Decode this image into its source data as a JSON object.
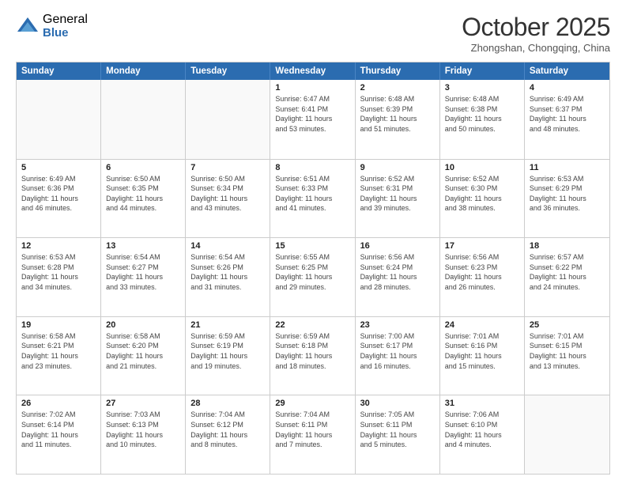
{
  "logo": {
    "general": "General",
    "blue": "Blue"
  },
  "header": {
    "month": "October 2025",
    "location": "Zhongshan, Chongqing, China"
  },
  "weekdays": [
    "Sunday",
    "Monday",
    "Tuesday",
    "Wednesday",
    "Thursday",
    "Friday",
    "Saturday"
  ],
  "weeks": [
    [
      {
        "day": "",
        "info": ""
      },
      {
        "day": "",
        "info": ""
      },
      {
        "day": "",
        "info": ""
      },
      {
        "day": "1",
        "info": "Sunrise: 6:47 AM\nSunset: 6:41 PM\nDaylight: 11 hours\nand 53 minutes."
      },
      {
        "day": "2",
        "info": "Sunrise: 6:48 AM\nSunset: 6:39 PM\nDaylight: 11 hours\nand 51 minutes."
      },
      {
        "day": "3",
        "info": "Sunrise: 6:48 AM\nSunset: 6:38 PM\nDaylight: 11 hours\nand 50 minutes."
      },
      {
        "day": "4",
        "info": "Sunrise: 6:49 AM\nSunset: 6:37 PM\nDaylight: 11 hours\nand 48 minutes."
      }
    ],
    [
      {
        "day": "5",
        "info": "Sunrise: 6:49 AM\nSunset: 6:36 PM\nDaylight: 11 hours\nand 46 minutes."
      },
      {
        "day": "6",
        "info": "Sunrise: 6:50 AM\nSunset: 6:35 PM\nDaylight: 11 hours\nand 44 minutes."
      },
      {
        "day": "7",
        "info": "Sunrise: 6:50 AM\nSunset: 6:34 PM\nDaylight: 11 hours\nand 43 minutes."
      },
      {
        "day": "8",
        "info": "Sunrise: 6:51 AM\nSunset: 6:33 PM\nDaylight: 11 hours\nand 41 minutes."
      },
      {
        "day": "9",
        "info": "Sunrise: 6:52 AM\nSunset: 6:31 PM\nDaylight: 11 hours\nand 39 minutes."
      },
      {
        "day": "10",
        "info": "Sunrise: 6:52 AM\nSunset: 6:30 PM\nDaylight: 11 hours\nand 38 minutes."
      },
      {
        "day": "11",
        "info": "Sunrise: 6:53 AM\nSunset: 6:29 PM\nDaylight: 11 hours\nand 36 minutes."
      }
    ],
    [
      {
        "day": "12",
        "info": "Sunrise: 6:53 AM\nSunset: 6:28 PM\nDaylight: 11 hours\nand 34 minutes."
      },
      {
        "day": "13",
        "info": "Sunrise: 6:54 AM\nSunset: 6:27 PM\nDaylight: 11 hours\nand 33 minutes."
      },
      {
        "day": "14",
        "info": "Sunrise: 6:54 AM\nSunset: 6:26 PM\nDaylight: 11 hours\nand 31 minutes."
      },
      {
        "day": "15",
        "info": "Sunrise: 6:55 AM\nSunset: 6:25 PM\nDaylight: 11 hours\nand 29 minutes."
      },
      {
        "day": "16",
        "info": "Sunrise: 6:56 AM\nSunset: 6:24 PM\nDaylight: 11 hours\nand 28 minutes."
      },
      {
        "day": "17",
        "info": "Sunrise: 6:56 AM\nSunset: 6:23 PM\nDaylight: 11 hours\nand 26 minutes."
      },
      {
        "day": "18",
        "info": "Sunrise: 6:57 AM\nSunset: 6:22 PM\nDaylight: 11 hours\nand 24 minutes."
      }
    ],
    [
      {
        "day": "19",
        "info": "Sunrise: 6:58 AM\nSunset: 6:21 PM\nDaylight: 11 hours\nand 23 minutes."
      },
      {
        "day": "20",
        "info": "Sunrise: 6:58 AM\nSunset: 6:20 PM\nDaylight: 11 hours\nand 21 minutes."
      },
      {
        "day": "21",
        "info": "Sunrise: 6:59 AM\nSunset: 6:19 PM\nDaylight: 11 hours\nand 19 minutes."
      },
      {
        "day": "22",
        "info": "Sunrise: 6:59 AM\nSunset: 6:18 PM\nDaylight: 11 hours\nand 18 minutes."
      },
      {
        "day": "23",
        "info": "Sunrise: 7:00 AM\nSunset: 6:17 PM\nDaylight: 11 hours\nand 16 minutes."
      },
      {
        "day": "24",
        "info": "Sunrise: 7:01 AM\nSunset: 6:16 PM\nDaylight: 11 hours\nand 15 minutes."
      },
      {
        "day": "25",
        "info": "Sunrise: 7:01 AM\nSunset: 6:15 PM\nDaylight: 11 hours\nand 13 minutes."
      }
    ],
    [
      {
        "day": "26",
        "info": "Sunrise: 7:02 AM\nSunset: 6:14 PM\nDaylight: 11 hours\nand 11 minutes."
      },
      {
        "day": "27",
        "info": "Sunrise: 7:03 AM\nSunset: 6:13 PM\nDaylight: 11 hours\nand 10 minutes."
      },
      {
        "day": "28",
        "info": "Sunrise: 7:04 AM\nSunset: 6:12 PM\nDaylight: 11 hours\nand 8 minutes."
      },
      {
        "day": "29",
        "info": "Sunrise: 7:04 AM\nSunset: 6:11 PM\nDaylight: 11 hours\nand 7 minutes."
      },
      {
        "day": "30",
        "info": "Sunrise: 7:05 AM\nSunset: 6:11 PM\nDaylight: 11 hours\nand 5 minutes."
      },
      {
        "day": "31",
        "info": "Sunrise: 7:06 AM\nSunset: 6:10 PM\nDaylight: 11 hours\nand 4 minutes."
      },
      {
        "day": "",
        "info": ""
      }
    ]
  ]
}
